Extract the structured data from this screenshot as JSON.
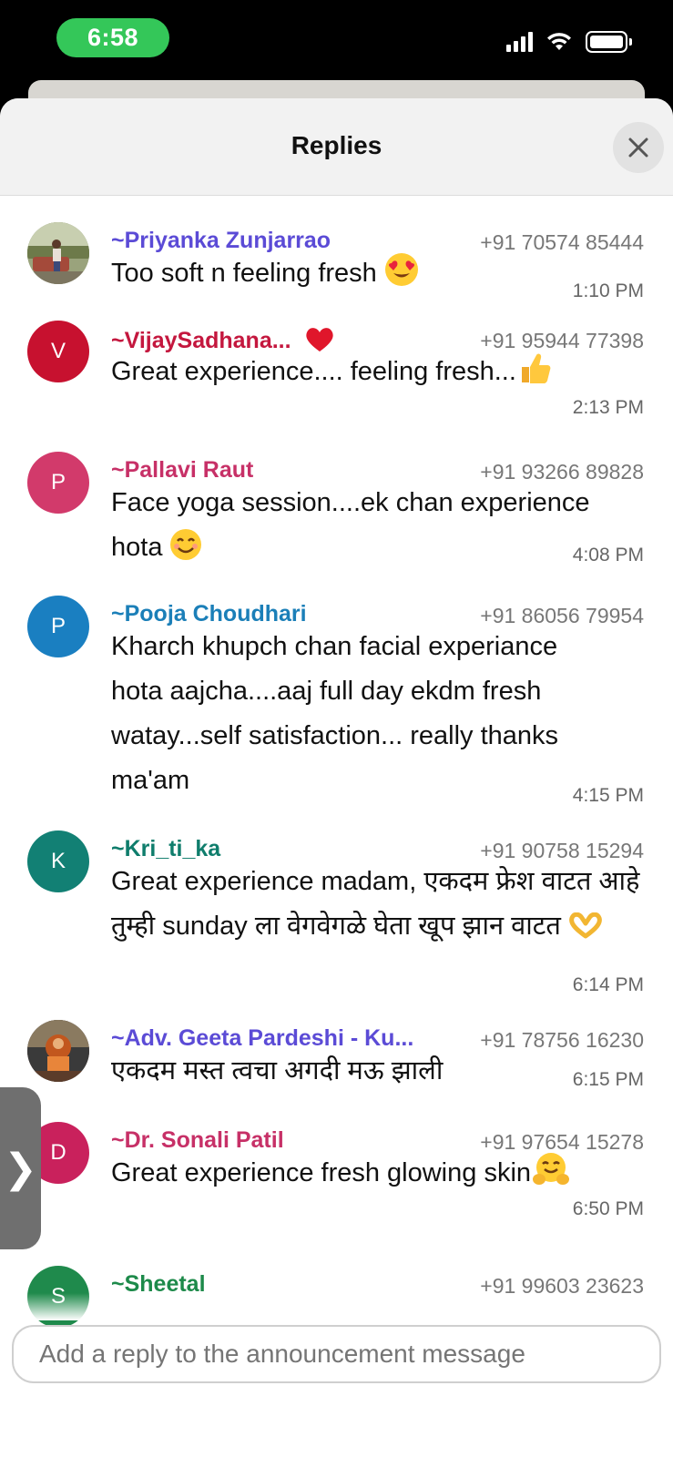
{
  "status_bar": {
    "time": "6:58",
    "time_pill_color": "#34c759"
  },
  "sheet": {
    "title": "Replies",
    "close_icon": "close-icon"
  },
  "replies": [
    {
      "sender": "~Priyanka Zunjarrao",
      "sender_color": "#5b4bd6",
      "phone": "+91 70574 85444",
      "text": "Too soft n feeling fresh",
      "emoji": "heart-eyes",
      "time": "1:10 PM",
      "avatar_type": "photo"
    },
    {
      "sender": "~VijaySadhana... ",
      "sender_color": "#c4173e",
      "phone": "+91 95944 77398",
      "text": "Great experience.... feeling fresh...",
      "emoji": "thumbs-up",
      "time": "2:13 PM",
      "avatar_letter": "V",
      "avatar_color": "#c7112f",
      "sender_emoji": "red-heart"
    },
    {
      "sender": "~Pallavi Raut",
      "sender_color": "#c73067",
      "phone": "+91 93266 89828",
      "text": "Face yoga session....ek chan experience hota",
      "emoji": "smile",
      "time": "4:08 PM",
      "avatar_letter": "P",
      "avatar_color": "#d23a6b"
    },
    {
      "sender": "~Pooja Choudhari",
      "sender_color": "#1b7fb8",
      "phone": "+91 86056 79954",
      "text": "Kharch khupch chan facial experiance hota aajcha....aaj full day ekdm fresh watay...self satisfaction... really thanks ma'am",
      "time": "4:15 PM",
      "avatar_letter": "P",
      "avatar_color": "#1a7fc1"
    },
    {
      "sender": "~Kri_ti_ka",
      "sender_color": "#0f7d6c",
      "phone": "+91 90758 15294",
      "text": "Great experience madam, एकदम फ्रेश वाटत आहे तुम्ही sunday ला वेगवेगळे घेता खूप झान वाटत",
      "emoji": "heart-hands",
      "time": "6:14 PM",
      "avatar_letter": "K",
      "avatar_color": "#128074"
    },
    {
      "sender": "~Adv. Geeta Pardeshi - Ku...",
      "sender_color": "#5b4bd6",
      "phone": "+91 78756 16230",
      "text": "एकदम मस्त त्वचा अगदी मऊ झाली",
      "time": "6:15 PM",
      "avatar_type": "photo"
    },
    {
      "sender": "~Dr. Sonali Patil",
      "sender_color": "#c73067",
      "phone": "+91 97654 15278",
      "text": "Great experience fresh glowing skin",
      "emoji": "hugging",
      "time": "6:50 PM",
      "avatar_letter": "D",
      "avatar_color": "#c9215c"
    },
    {
      "sender": "~Sheetal",
      "sender_color": "#1d8a4a",
      "phone": "+91 99603 23623",
      "text": "",
      "time": "",
      "avatar_letter": "S",
      "avatar_color": "#1f8a4c"
    }
  ],
  "edge_tab": {
    "glyph": "❯"
  },
  "input": {
    "placeholder": "Add a reply to the announcement message"
  }
}
